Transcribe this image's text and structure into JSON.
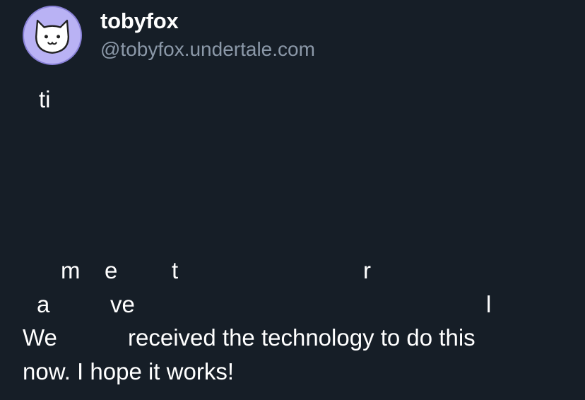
{
  "author": {
    "display_name": "tobyfox",
    "handle": "@tobyfox.undertale.com",
    "avatar_icon": "white-dog-icon",
    "avatar_bg": "#b9b2f4"
  },
  "post": {
    "fragments": {
      "ti": "ti",
      "m": "m",
      "e": "e",
      "t": "t",
      "r": "r",
      "a": "a",
      "ve": "ve",
      "l": "l",
      "we": "We"
    },
    "line_4_rest": "received the technology to do this",
    "line_5": "now. I hope it works!"
  },
  "colors": {
    "background": "#161e27",
    "text": "#ffffff",
    "handle": "#8b98a8"
  }
}
